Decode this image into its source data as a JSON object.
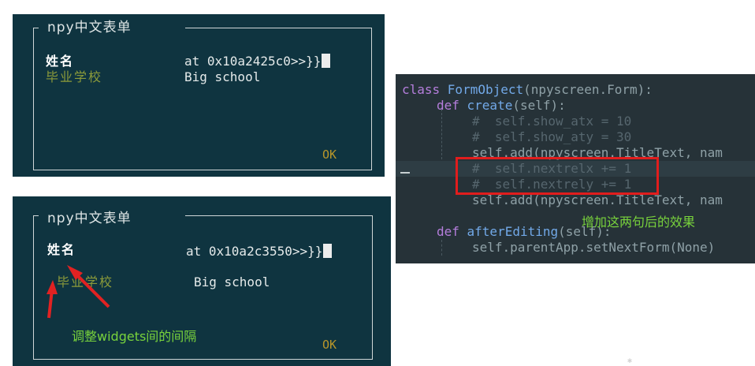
{
  "terminal_before": {
    "form_title": "npy中文表单",
    "name_label": "姓名",
    "name_value": "at 0x10a2425c0>>}}",
    "school_label": "毕业学校",
    "school_value": "Big school",
    "ok_label": "OK"
  },
  "terminal_after": {
    "form_title": "npy中文表单",
    "name_label": "姓名",
    "name_value": "at 0x10a2c3550>>}}",
    "school_label": "毕业学校",
    "school_value": "Big school",
    "ok_label": "OK",
    "annotation": "调整widgets间的间隔"
  },
  "code_editor": {
    "lines": [
      {
        "kw": "class ",
        "fn": "FormObject",
        "pl": "(npyscreen.Form):"
      },
      {
        "kw": "def ",
        "fn": "create",
        "pl": "(self):"
      },
      {
        "cm": "#  self.show_atx = 10"
      },
      {
        "cm": "#  self.show_aty = 30"
      },
      {
        "pl": "self.add(npyscreen.TitleText, nam"
      },
      {
        "cm": "#  self.nextrelx += 1"
      },
      {
        "cm": "#  self.nextrely += 1"
      },
      {
        "pl": "self.add(npyscreen.TitleText, nam"
      },
      {
        "pl": ""
      },
      {
        "kw": "def ",
        "fn": "afterEditing",
        "pl": "(self):"
      },
      {
        "pl": "self.parentApp.setNextForm(None)"
      }
    ],
    "annotation": "增加这两句后的效果"
  },
  "colors": {
    "terminal_bg": "#0f3440",
    "school_label": "#8b9a3a",
    "ok": "#b8962a",
    "annotation_green": "#78d23c",
    "highlight_box": "#e11d1d",
    "editor_bg": "#263238"
  }
}
